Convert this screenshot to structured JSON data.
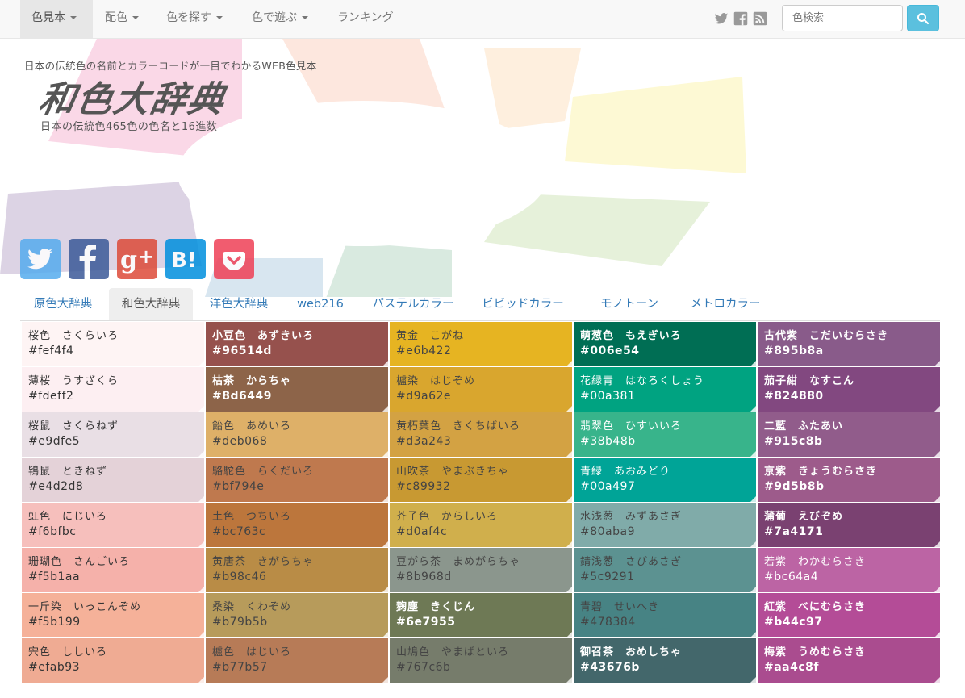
{
  "nav": {
    "items": [
      {
        "label": "色見本",
        "caret": true
      },
      {
        "label": "配色",
        "caret": true
      },
      {
        "label": "色を探す",
        "caret": true
      },
      {
        "label": "色で遊ぶ",
        "caret": true
      },
      {
        "label": "ランキング",
        "caret": false
      }
    ],
    "search_placeholder": "色検索"
  },
  "header": {
    "tagline": "日本の伝統色の名前とカラーコードが一目でわかるWEB色見本",
    "logo": "和色大辞典",
    "subtitle": "日本の伝統色465色の色名と16進数"
  },
  "tabs": [
    "原色大辞典",
    "和色大辞典",
    "洋色大辞典",
    "web216",
    "パステルカラー",
    "ビビッドカラー",
    "モノトーン",
    "メトロカラー"
  ],
  "colors": [
    [
      {
        "name": "桜色　さくらいろ",
        "hex": "#fef4f4"
      },
      {
        "name": "薄桜　うすざくら",
        "hex": "#fdeff2"
      },
      {
        "name": "桜鼠　さくらねず",
        "hex": "#e9dfe5"
      },
      {
        "name": "鴇鼠　ときねず",
        "hex": "#e4d2d8"
      },
      {
        "name": "虹色　にじいろ",
        "hex": "#f6bfbc"
      },
      {
        "name": "珊瑚色　さんごいろ",
        "hex": "#f5b1aa"
      },
      {
        "name": "一斤染　いっこんぞめ",
        "hex": "#f5b199"
      },
      {
        "name": "宍色　ししいろ",
        "hex": "#efab93"
      }
    ],
    [
      {
        "name": "小豆色　あずきいろ",
        "hex": "#96514d"
      },
      {
        "name": "枯茶　からちゃ",
        "hex": "#8d6449"
      },
      {
        "name": "飴色　あめいろ",
        "hex": "#deb068"
      },
      {
        "name": "駱駝色　らくだいろ",
        "hex": "#bf794e"
      },
      {
        "name": "土色　つちいろ",
        "hex": "#bc763c"
      },
      {
        "name": "黄唐茶　きがらちゃ",
        "hex": "#b98c46"
      },
      {
        "name": "桑染　くわぞめ",
        "hex": "#b79b5b"
      },
      {
        "name": "櫨色　はじいろ",
        "hex": "#b77b57"
      }
    ],
    [
      {
        "name": "黄金　こがね",
        "hex": "#e6b422"
      },
      {
        "name": "櫨染　はじぞめ",
        "hex": "#d9a62e"
      },
      {
        "name": "黄朽葉色　きくちばいろ",
        "hex": "#d3a243"
      },
      {
        "name": "山吹茶　やまぶきちゃ",
        "hex": "#c89932"
      },
      {
        "name": "芥子色　からしいろ",
        "hex": "#d0af4c"
      },
      {
        "name": "豆がら茶　まめがらちゃ",
        "hex": "#8b968d"
      },
      {
        "name": "麹塵　きくじん",
        "hex": "#6e7955"
      },
      {
        "name": "山鳩色　やまばといろ",
        "hex": "#767c6b"
      }
    ],
    [
      {
        "name": "萌葱色　もえぎいろ",
        "hex": "#006e54"
      },
      {
        "name": "花緑青　はなろくしょう",
        "hex": "#00a381"
      },
      {
        "name": "翡翠色　ひすいいろ",
        "hex": "#38b48b"
      },
      {
        "name": "青緑　あおみどり",
        "hex": "#00a497"
      },
      {
        "name": "水浅葱　みずあさぎ",
        "hex": "#80aba9"
      },
      {
        "name": "錆浅葱　さびあさぎ",
        "hex": "#5c9291"
      },
      {
        "name": "青碧　せいへき",
        "hex": "#478384"
      },
      {
        "name": "御召茶　おめしちゃ",
        "hex": "#43676b"
      }
    ],
    [
      {
        "name": "古代紫　こだいむらさき",
        "hex": "#895b8a"
      },
      {
        "name": "茄子紺　なすこん",
        "hex": "#824880"
      },
      {
        "name": "二藍　ふたあい",
        "hex": "#915c8b"
      },
      {
        "name": "京紫　きょうむらさき",
        "hex": "#9d5b8b"
      },
      {
        "name": "蒲葡　えびぞめ",
        "hex": "#7a4171"
      },
      {
        "name": "若紫　わかむらさき",
        "hex": "#bc64a4"
      },
      {
        "name": "紅紫　べにむらさき",
        "hex": "#b44c97"
      },
      {
        "name": "梅紫　うめむらさき",
        "hex": "#aa4c8f"
      }
    ]
  ],
  "text_styles": [
    [
      "light",
      "light",
      "light",
      "light",
      "light",
      "light",
      "light",
      "light"
    ],
    [
      "dark",
      "dark",
      "mid2",
      "mid2",
      "mid2",
      "mid2",
      "mid2",
      "mid2"
    ],
    [
      "mid2",
      "mid2",
      "mid2",
      "mid2",
      "mid2",
      "mid2",
      "dark",
      "mid2"
    ],
    [
      "dark",
      "mid",
      "mid",
      "mid",
      "mid2",
      "mid2",
      "mid2",
      "dark"
    ],
    [
      "dark",
      "dark",
      "dark",
      "dark",
      "dark",
      "mid",
      "dark",
      "dark"
    ]
  ]
}
